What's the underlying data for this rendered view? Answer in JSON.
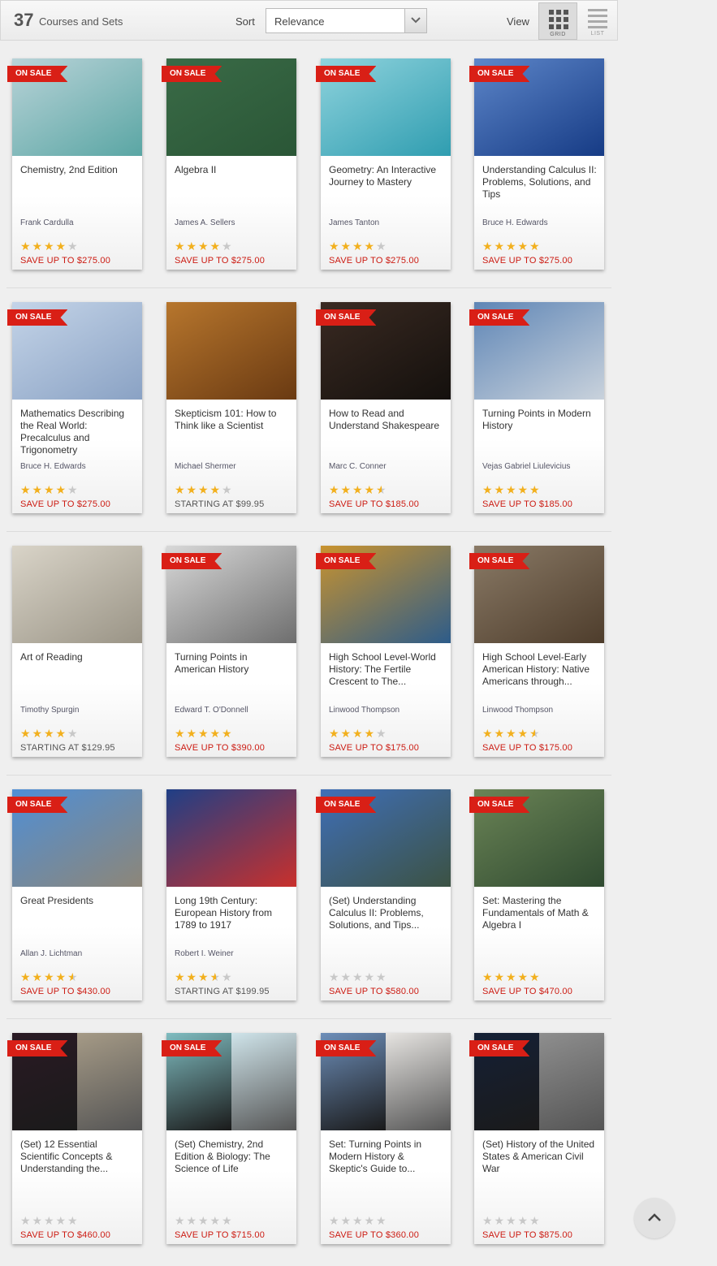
{
  "toolbar": {
    "count": "37",
    "count_label": "Courses and Sets",
    "sort_label": "Sort",
    "sort_value": "Relevance",
    "view_label": "View",
    "grid_label": "GRID",
    "list_label": "LIST"
  },
  "colors": {
    "accent_red": "#d91f16",
    "star_gold": "#f2b01e",
    "star_empty": "#c8c8c8"
  },
  "courses": [
    {
      "title": "Chemistry, 2nd Edition",
      "author": "Frank Cardulla",
      "rating": 4,
      "price": "SAVE UP TO $275.00",
      "on_sale": true,
      "badge": "ON SALE",
      "image": "chemistry-beakers",
      "bg": [
        "#b9d3d8",
        "#5aa6a4"
      ]
    },
    {
      "title": "Algebra II",
      "author": "James A. Sellers",
      "rating": 4,
      "price": "SAVE UP TO $275.00",
      "on_sale": true,
      "badge": "ON SALE",
      "image": "chalkboard-teacher",
      "bg": [
        "#3a6b47",
        "#2a5636"
      ]
    },
    {
      "title": "Geometry: An Interactive Journey to Mastery",
      "author": "James Tanton",
      "rating": 4,
      "price": "SAVE UP TO $275.00",
      "on_sale": true,
      "badge": "ON SALE",
      "image": "polyhedron",
      "bg": [
        "#8fd3dd",
        "#2f9db0"
      ]
    },
    {
      "title": "Understanding Calculus II: Problems, Solutions, and Tips",
      "author": "Bruce H. Edwards",
      "rating": 5,
      "price": "SAVE UP TO $275.00",
      "on_sale": true,
      "badge": "ON SALE",
      "image": "math-formulas",
      "bg": [
        "#5d86c9",
        "#163b85"
      ]
    },
    {
      "title": "Mathematics Describing the Real World: Precalculus and Trigonometry",
      "author": "Bruce H. Edwards",
      "rating": 4,
      "price": "SAVE UP TO $275.00",
      "on_sale": true,
      "badge": "ON SALE",
      "image": "ball-bearings",
      "bg": [
        "#c4d4e8",
        "#8aa2c4"
      ]
    },
    {
      "title": "Skepticism 101: How to Think like a Scientist",
      "author": "Michael Shermer",
      "rating": 4,
      "price": "STARTING AT $99.95",
      "on_sale": false,
      "badge": "",
      "image": "question-marks-yes",
      "bg": [
        "#b7762d",
        "#6a3a12"
      ]
    },
    {
      "title": "How to Read and Understand Shakespeare",
      "author": "Marc C. Conner",
      "rating": 4.5,
      "price": "SAVE UP TO $185.00",
      "on_sale": true,
      "badge": "ON SALE",
      "image": "shakespeare-portrait",
      "bg": [
        "#3a2a22",
        "#14100d"
      ]
    },
    {
      "title": "Turning Points in Modern History",
      "author": "Vejas Gabriel Liulevicius",
      "rating": 5,
      "price": "SAVE UP TO $185.00",
      "on_sale": true,
      "badge": "ON SALE",
      "image": "rocket-launch",
      "bg": [
        "#5f86b6",
        "#c9d2dc"
      ]
    },
    {
      "title": "Art of Reading",
      "author": "Timothy Spurgin",
      "rating": 4,
      "price": "STARTING AT $129.95",
      "on_sale": false,
      "badge": "",
      "image": "man-reading",
      "bg": [
        "#d9d4c8",
        "#9a9486"
      ]
    },
    {
      "title": "Turning Points in American History",
      "author": "Edward T. O'Donnell",
      "rating": 5,
      "price": "SAVE UP TO $390.00",
      "on_sale": true,
      "badge": "ON SALE",
      "image": "statue-of-liberty-immigrants",
      "bg": [
        "#d8d8d8",
        "#6e6e6e"
      ]
    },
    {
      "title": "High School Level-World History: The Fertile Crescent to The...",
      "author": "Linwood Thompson",
      "rating": 4,
      "price": "SAVE UP TO $175.00",
      "on_sale": true,
      "badge": "ON SALE",
      "image": "egyptian-art",
      "bg": [
        "#c9932e",
        "#2d5c8a"
      ]
    },
    {
      "title": "High School Level-Early American History: Native Americans through...",
      "author": "Linwood Thompson",
      "rating": 4.5,
      "price": "SAVE UP TO $175.00",
      "on_sale": true,
      "badge": "ON SALE",
      "image": "revolutionary-painting",
      "bg": [
        "#8a7a66",
        "#4e3d2c"
      ]
    },
    {
      "title": "Great Presidents",
      "author": "Allan J. Lichtman",
      "rating": 4.5,
      "price": "SAVE UP TO $430.00",
      "on_sale": true,
      "badge": "ON SALE",
      "image": "mount-rushmore",
      "bg": [
        "#4f8fd6",
        "#8d8678"
      ]
    },
    {
      "title": "Long 19th Century: European History from 1789 to 1917",
      "author": "Robert I. Weiner",
      "rating": 3.5,
      "price": "STARTING AT $199.95",
      "on_sale": false,
      "badge": "",
      "image": "liberte-medallion",
      "bg": [
        "#1f3f86",
        "#c9302c"
      ]
    },
    {
      "title": "(Set) Understanding Calculus II: Problems, Solutions, and Tips...",
      "author": "",
      "rating": 0,
      "price": "SAVE UP TO $580.00",
      "on_sale": true,
      "badge": "ON SALE",
      "image": "woman-chalkboard-formulas",
      "bg": [
        "#3f6fb8",
        "#3c5243"
      ]
    },
    {
      "title": "Set: Mastering the Fundamentals of Math & Algebra I",
      "author": "",
      "rating": 5,
      "price": "SAVE UP TO $470.00",
      "on_sale": true,
      "badge": "ON SALE",
      "image": "ruler-chalkboard",
      "bg": [
        "#6b8456",
        "#2f4a30"
      ]
    },
    {
      "title": "(Set) 12 Essential Scientific Concepts & Understanding the...",
      "author": "",
      "rating": 0,
      "price": "SAVE UP TO $460.00",
      "on_sale": true,
      "badge": "ON SALE",
      "image": "galaxy-and-steam-engine",
      "bg": [
        "#2a1a24",
        "#a59a86"
      ]
    },
    {
      "title": "(Set) Chemistry, 2nd Edition & Biology: The Science of Life",
      "author": "",
      "rating": 0,
      "price": "SAVE UP TO $715.00",
      "on_sale": true,
      "badge": "ON SALE",
      "image": "beakers-and-test-tube",
      "bg": [
        "#7fbcc0",
        "#cfe4ea"
      ]
    },
    {
      "title": "Set: Turning Points in Modern History & Skeptic's Guide to...",
      "author": "",
      "rating": 0,
      "price": "SAVE UP TO $360.00",
      "on_sale": true,
      "badge": "ON SALE",
      "image": "rocket-and-uncle-sam",
      "bg": [
        "#6d8eb9",
        "#e6e4e1"
      ]
    },
    {
      "title": "(Set) History of the United States & American Civil War",
      "author": "",
      "rating": 0,
      "price": "SAVE UP TO $875.00",
      "on_sale": true,
      "badge": "ON SALE",
      "image": "capitol-and-civil-war-soldier",
      "bg": [
        "#152036",
        "#8e8e8e"
      ]
    }
  ]
}
